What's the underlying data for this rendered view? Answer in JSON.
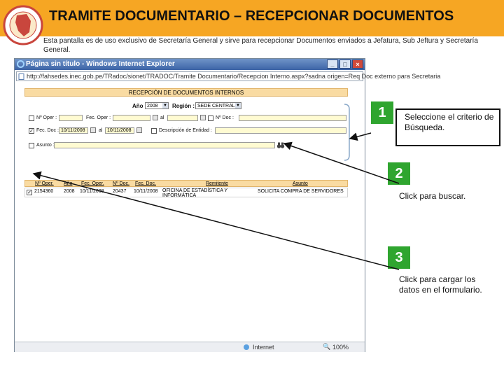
{
  "slide": {
    "title": "TRAMITE DOCUMENTARIO – RECEPCIONAR DOCUMENTOS",
    "description": "Esta pantalla es de uso exclusivo de Secretaría General y sirve para recepcionar Documentos enviados a Jefatura, Sub Jeftura y Secretaría General."
  },
  "ie": {
    "title": "Página sin título - Windows Internet Explorer",
    "address": "http://fahsedes.inec.gob.pe/TRadoc/sionet/TRADOC/Tramite Documentario/Recepcion Interno.aspx?sadna origen=Req Doc externo para Secretaria",
    "status_zone": "Internet",
    "status_zoom": "100%"
  },
  "form": {
    "title": "RECEPCIÓN DE DOCUMENTOS INTERNOS",
    "anio_label": "Año :",
    "anio_value": "2008",
    "region_label": "Región :",
    "region_value": "SEDE CENTRAL",
    "nro_oper_label": "Nº Oper :",
    "fec_oper_label": "Fec. Oper :",
    "al_label": "al",
    "nro_doc_label": "Nº Doc :",
    "fec_doc_label": "Fec. Doc :",
    "fec_doc_from": "10/11/2008",
    "fec_doc_to": "10/11/2008",
    "descripcion_label": "Descripción de Entidad :",
    "asunto_label": "Asunto :"
  },
  "grid": {
    "headers": [
      "Nº Oper.",
      "Año",
      "Fec. Oper.",
      "Nº Doc.",
      "Fec. Doc.",
      "Remitente",
      "Asunto"
    ],
    "rows": [
      [
        "2154360",
        "2008",
        "10/11/2008",
        "20437",
        "10/11/2008",
        "OFICINA DE ESTADÍSTICA Y INFORMÁTICA",
        "SOLICITA COMPRA DE SERVIDORES"
      ]
    ]
  },
  "callouts": [
    {
      "number": "1",
      "text": "Seleccione el criterio de Búsqueda."
    },
    {
      "number": "2",
      "text": "Click para buscar."
    },
    {
      "number": "3",
      "text": "Click para cargar los datos en el formulario."
    }
  ],
  "colors": {
    "header": "#f6a623",
    "badge": "#2fa52f",
    "form_header": "#f9dba2",
    "field_bg": "#fffbd2"
  }
}
